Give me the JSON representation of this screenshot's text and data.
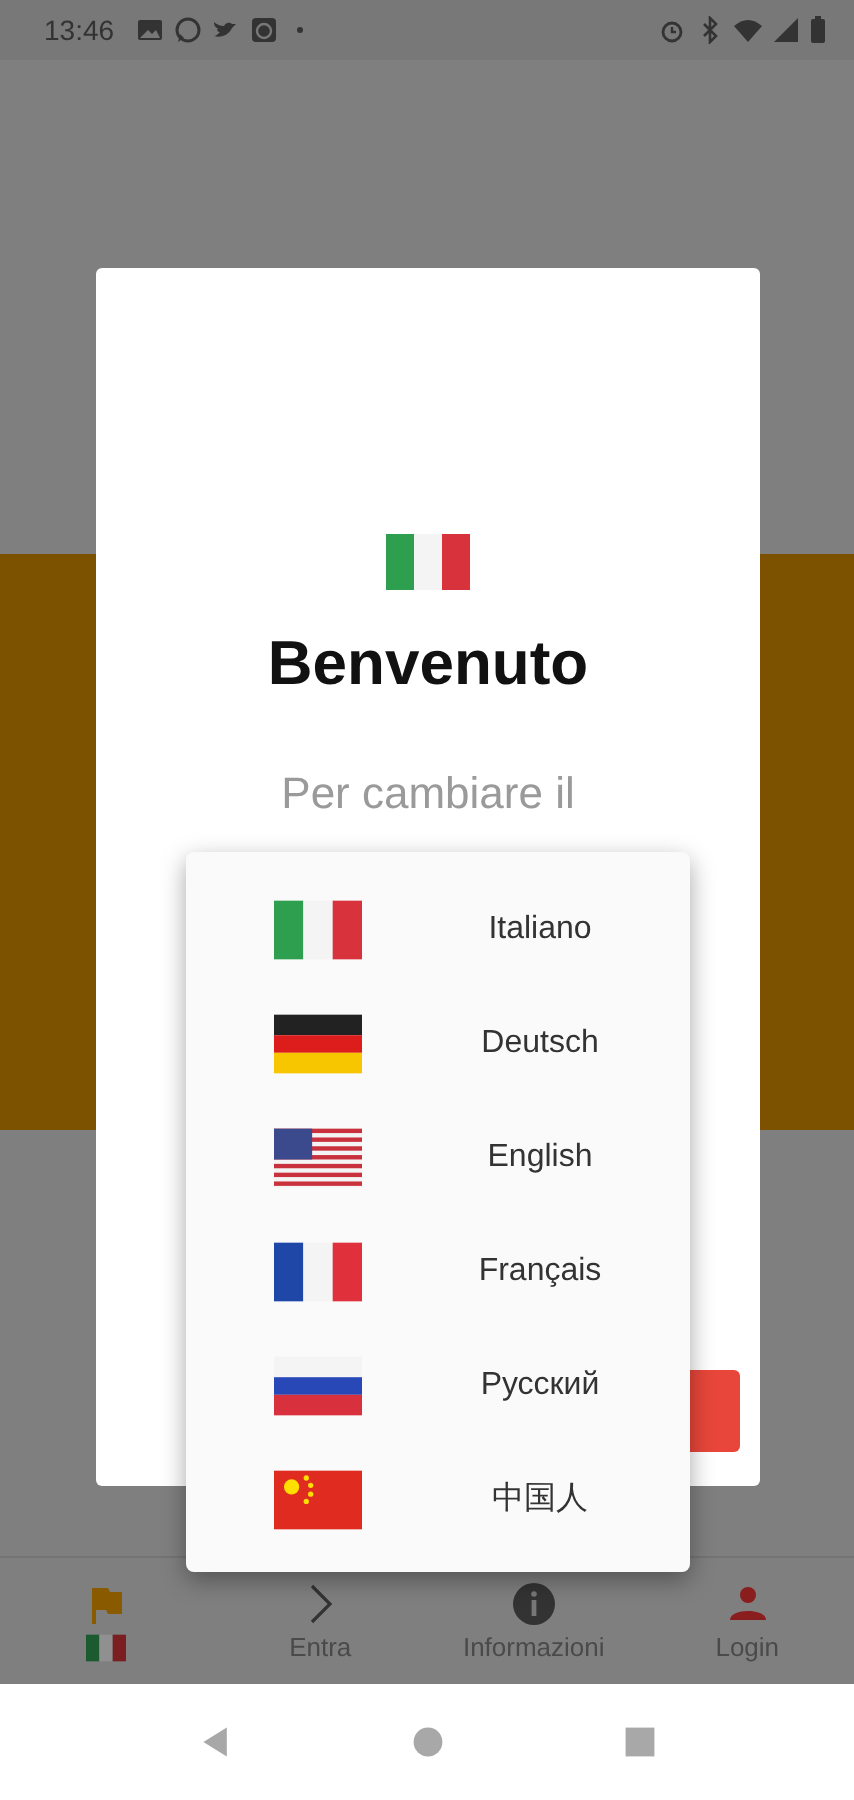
{
  "status_bar": {
    "time": "13:46"
  },
  "dialog": {
    "title": "Benvenuto",
    "message": "Per cambiare il"
  },
  "language_menu": [
    {
      "kind": "italy",
      "label": "Italiano"
    },
    {
      "kind": "germany",
      "label": "Deutsch"
    },
    {
      "kind": "usa",
      "label": "English"
    },
    {
      "kind": "france",
      "label": "Français"
    },
    {
      "kind": "russia",
      "label": "Русский"
    },
    {
      "kind": "china",
      "label": "中国人"
    }
  ],
  "bottom_nav": [
    {
      "kind": "language"
    },
    {
      "kind": "enter",
      "label": "Entra"
    },
    {
      "kind": "info",
      "label": "Informazioni"
    },
    {
      "kind": "login",
      "label": "Login"
    }
  ]
}
